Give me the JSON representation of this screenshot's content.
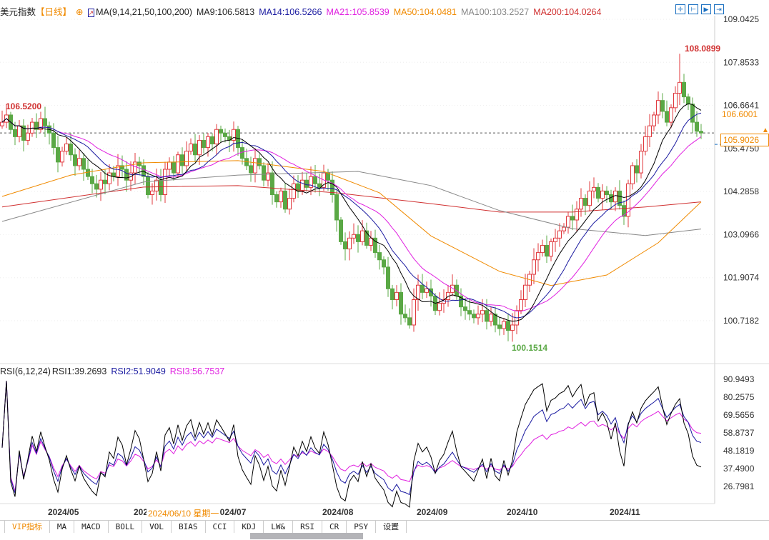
{
  "header": {
    "title": "美元指数",
    "period": "【日线】",
    "ma_label": "MA(9,14,21,50,100,200)",
    "ma9": "MA9:106.5813",
    "ma14": "MA14:106.5266",
    "ma21": "MA21:105.8539",
    "ma50": "MA50:104.0481",
    "ma100": "MA100:103.2527",
    "ma200": "MA200:104.0264"
  },
  "rsi_header": {
    "label": "RSI(6,12,24)",
    "rsi1": "RSI1:39.2693",
    "rsi2": "RSI2:51.9049",
    "rsi3": "RSI3:56.7537"
  },
  "colors": {
    "up": "#e0393e",
    "down": "#5aa845",
    "ma9": "#000000",
    "ma14": "#1a1aa0",
    "ma21": "#e020e0",
    "ma50": "#f08a00",
    "ma100": "#888888",
    "ma200": "#d03030"
  },
  "annotations": {
    "start": "106.5200",
    "high": "108.0899",
    "low": "100.1514",
    "ma50_tag": "106.6001",
    "current": "105.9026"
  },
  "tooltip": "2024/06/10 星期一",
  "tabs": [
    "VIP指标",
    "MA",
    "MACD",
    "BOLL",
    "VOL",
    "BIAS",
    "CCI",
    "KDJ",
    "LW&",
    "RSI",
    "CR",
    "PSY",
    "设置"
  ],
  "chart_data": {
    "type": "candlestick",
    "price_ticks": [
      "109.0425",
      "107.8533",
      "106.6641",
      "105.4750",
      "104.2858",
      "103.0966",
      "101.9074",
      "100.7182"
    ],
    "price_range": [
      100.7182,
      109.0425
    ],
    "rsi_ticks": [
      "90.9493",
      "80.2575",
      "69.5656",
      "58.8737",
      "48.1819",
      "37.4900",
      "26.7981"
    ],
    "rsi_range": [
      26.7981,
      90.9493
    ],
    "x_labels": [
      {
        "i": 14,
        "t": "2024/05"
      },
      {
        "i": 34,
        "t": "2024"
      },
      {
        "i": 53,
        "t": "2024/07"
      },
      {
        "i": 78,
        "t": "2024/08"
      },
      {
        "i": 100,
        "t": "2024/09"
      },
      {
        "i": 121,
        "t": "2024/10"
      },
      {
        "i": 145,
        "t": "2024/11"
      }
    ],
    "closes": [
      106.2,
      106.4,
      106.0,
      105.8,
      106.1,
      105.7,
      105.9,
      106.2,
      106.0,
      106.3,
      106.1,
      105.9,
      105.5,
      105.1,
      105.4,
      105.6,
      105.3,
      105.0,
      105.2,
      104.9,
      104.7,
      104.5,
      104.35,
      104.6,
      104.5,
      104.8,
      104.7,
      105.0,
      104.9,
      104.6,
      104.8,
      105.1,
      105.0,
      104.7,
      104.2,
      104.3,
      104.6,
      104.2,
      104.9,
      105.1,
      104.8,
      105.3,
      105.0,
      105.4,
      105.6,
      105.3,
      105.7,
      105.5,
      105.8,
      105.6,
      106.0,
      105.9,
      105.8,
      105.7,
      106.0,
      105.5,
      105.2,
      105.0,
      104.8,
      105.2,
      105.0,
      104.6,
      104.8,
      104.2,
      104.0,
      104.3,
      103.8,
      104.1,
      104.5,
      104.3,
      104.6,
      104.4,
      104.7,
      104.5,
      104.4,
      104.8,
      104.6,
      104.2,
      103.5,
      102.9,
      102.7,
      103.0,
      103.1,
      102.9,
      103.2,
      102.8,
      103.0,
      102.6,
      102.4,
      102.2,
      101.6,
      101.3,
      101.5,
      100.9,
      100.8,
      100.6,
      101.3,
      101.7,
      101.5,
      101.6,
      101.4,
      101.0,
      101.2,
      101.3,
      101.5,
      101.7,
      101.4,
      101.1,
      101.0,
      100.9,
      100.8,
      100.9,
      101.0,
      100.7,
      100.9,
      100.6,
      100.5,
      100.7,
      100.45,
      100.6,
      101.0,
      101.3,
      101.7,
      102.0,
      102.4,
      102.6,
      102.8,
      102.5,
      102.9,
      103.0,
      103.2,
      103.3,
      103.6,
      103.5,
      103.8,
      104.1,
      103.9,
      104.3,
      104.4,
      104.1,
      104.3,
      104.2,
      104.0,
      104.3,
      103.9,
      103.6,
      104.5,
      105.0,
      104.8,
      105.4,
      105.8,
      106.1,
      106.4,
      106.8,
      106.5,
      106.2,
      106.6,
      107.0,
      107.3,
      106.9,
      106.7,
      106.2,
      105.95,
      105.9026
    ],
    "first_open": 106.1,
    "extremes": {
      "high_index": 158,
      "high": 108.0899,
      "low_index": 118,
      "low": 100.1514,
      "start_high": 106.52
    },
    "ma50_points": [
      [
        0,
        104.15
      ],
      [
        16,
        104.74
      ],
      [
        33,
        105.08
      ],
      [
        55,
        105.14
      ],
      [
        75,
        104.84
      ],
      [
        88,
        104.25
      ],
      [
        100,
        103.06
      ],
      [
        116,
        102.08
      ],
      [
        128,
        101.69
      ],
      [
        141,
        101.98
      ],
      [
        153,
        102.87
      ],
      [
        163,
        104.0
      ]
    ],
    "ma100_points": [
      [
        0,
        103.46
      ],
      [
        33,
        104.55
      ],
      [
        55,
        104.74
      ],
      [
        83,
        104.84
      ],
      [
        100,
        104.45
      ],
      [
        116,
        103.76
      ],
      [
        133,
        103.26
      ],
      [
        150,
        103.07
      ],
      [
        163,
        103.25
      ]
    ],
    "ma200_points": [
      [
        0,
        103.86
      ],
      [
        33,
        104.41
      ],
      [
        55,
        104.45
      ],
      [
        78,
        104.25
      ],
      [
        100,
        103.95
      ],
      [
        116,
        103.72
      ],
      [
        133,
        103.72
      ],
      [
        150,
        103.86
      ],
      [
        163,
        104.0
      ]
    ]
  }
}
